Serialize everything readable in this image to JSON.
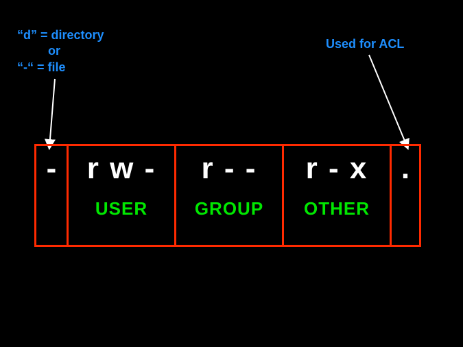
{
  "annotations": {
    "left": "“d” = directory\n         or\n“-“ = file",
    "right": "Used for ACL"
  },
  "cells": {
    "type": {
      "chars": "-",
      "label": ""
    },
    "user": {
      "chars": "r w -",
      "label": "USER"
    },
    "group": {
      "chars": "r - -",
      "label": "GROUP"
    },
    "other": {
      "chars": "r - x",
      "label": "OTHER"
    },
    "acl": {
      "chars": ".",
      "label": ""
    }
  }
}
